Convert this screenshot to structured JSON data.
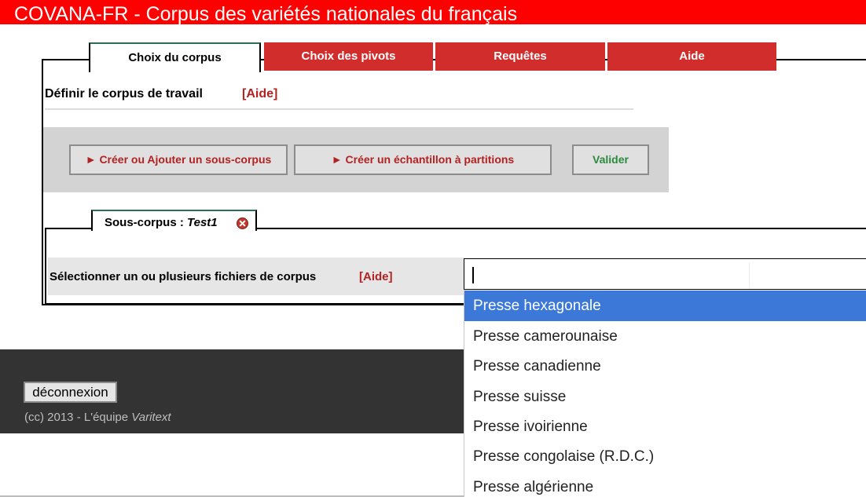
{
  "header": {
    "title": "COVANA-FR - Corpus des variétés nationales du français"
  },
  "tabs": [
    {
      "label": "Choix du corpus",
      "active": true
    },
    {
      "label": "Choix des pivots",
      "active": false
    },
    {
      "label": "Requêtes",
      "active": false
    },
    {
      "label": "Aide",
      "active": false
    }
  ],
  "define": {
    "label": "Définir le corpus de travail",
    "help": "[Aide]"
  },
  "actions": {
    "create_subcorpus": "► Créer ou Ajouter un sous-corpus",
    "create_sample": "► Créer un échantillon à partitions",
    "validate": "Valider"
  },
  "subcorpus": {
    "label_prefix": "Sous-corpus : ",
    "name": "Test1"
  },
  "select_files": {
    "label": "Sélectionner un ou plusieurs fichiers de corpus",
    "help": "[Aide]"
  },
  "search": {
    "value": ""
  },
  "dropdown": {
    "options": [
      "Presse hexagonale",
      "Presse camerounaise",
      "Presse canadienne",
      "Presse suisse",
      "Presse ivoirienne",
      "Presse congolaise (R.D.C.)",
      "Presse algérienne"
    ],
    "selected_index": 0
  },
  "footer": {
    "logout": "déconnexion",
    "copyright_prefix": "(cc) 2013 - L'équipe ",
    "copyright_team": "Varitext"
  },
  "colors": {
    "header": "#ff0000",
    "tab_red": "#d22d2d",
    "help_red": "#b22222",
    "validate_green": "#2b8a3e",
    "highlight": "#3b78d8",
    "footer": "#333333"
  }
}
